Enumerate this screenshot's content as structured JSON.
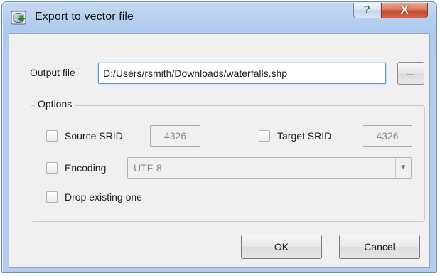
{
  "dialog": {
    "title": "Export to vector file",
    "help_glyph": "?",
    "close_glyph": "X"
  },
  "output": {
    "label": "Output file",
    "value": "D:/Users/rsmith/Downloads/waterfalls.shp",
    "browse_label": "..."
  },
  "options": {
    "title": "Options",
    "source_srid": {
      "label": "Source SRID",
      "checked": false,
      "value": "4326"
    },
    "target_srid": {
      "label": "Target SRID",
      "checked": false,
      "value": "4326"
    },
    "encoding": {
      "label": "Encoding",
      "checked": false,
      "value": "UTF-8"
    },
    "drop_existing": {
      "label": "Drop existing one",
      "checked": false
    }
  },
  "buttons": {
    "ok": "OK",
    "cancel": "Cancel"
  }
}
